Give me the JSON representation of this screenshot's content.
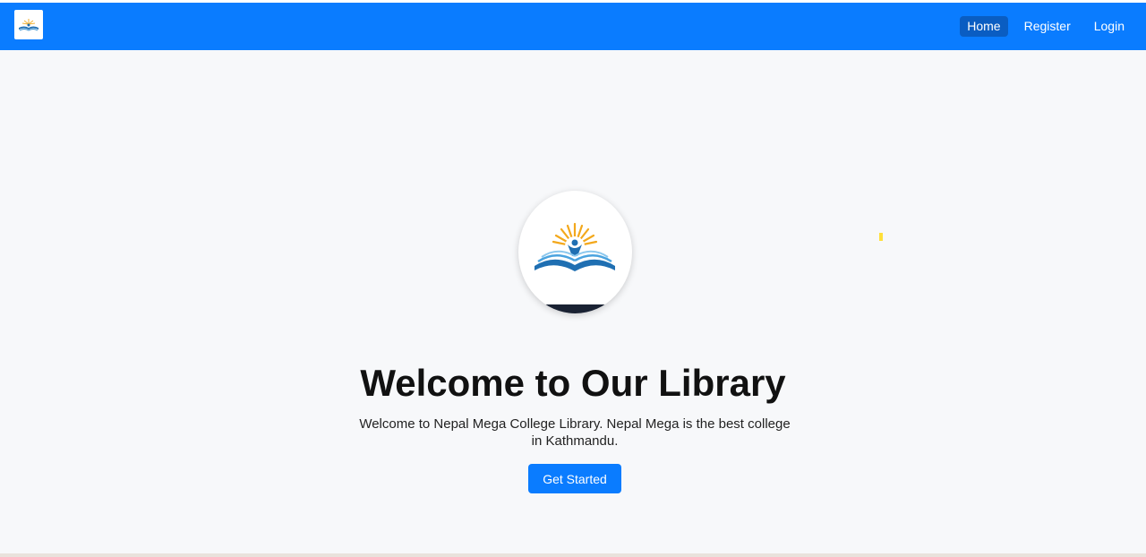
{
  "nav": {
    "links": [
      {
        "label": "Home"
      },
      {
        "label": "Register"
      },
      {
        "label": "Login"
      }
    ]
  },
  "hero": {
    "title": "Welcome to Our Library",
    "subtitle": "Welcome to Nepal Mega College Library. Nepal Mega is the best college in Kathmandu.",
    "cta_label": "Get Started"
  },
  "icons": {
    "brand": "library-logo-icon",
    "hero": "open-book-sunrise-logo"
  },
  "colors": {
    "navbar": "#0a7cff",
    "active_nav": "#0a5dc2",
    "page_background": "#f7f8fa",
    "button": "#0a7cff"
  }
}
